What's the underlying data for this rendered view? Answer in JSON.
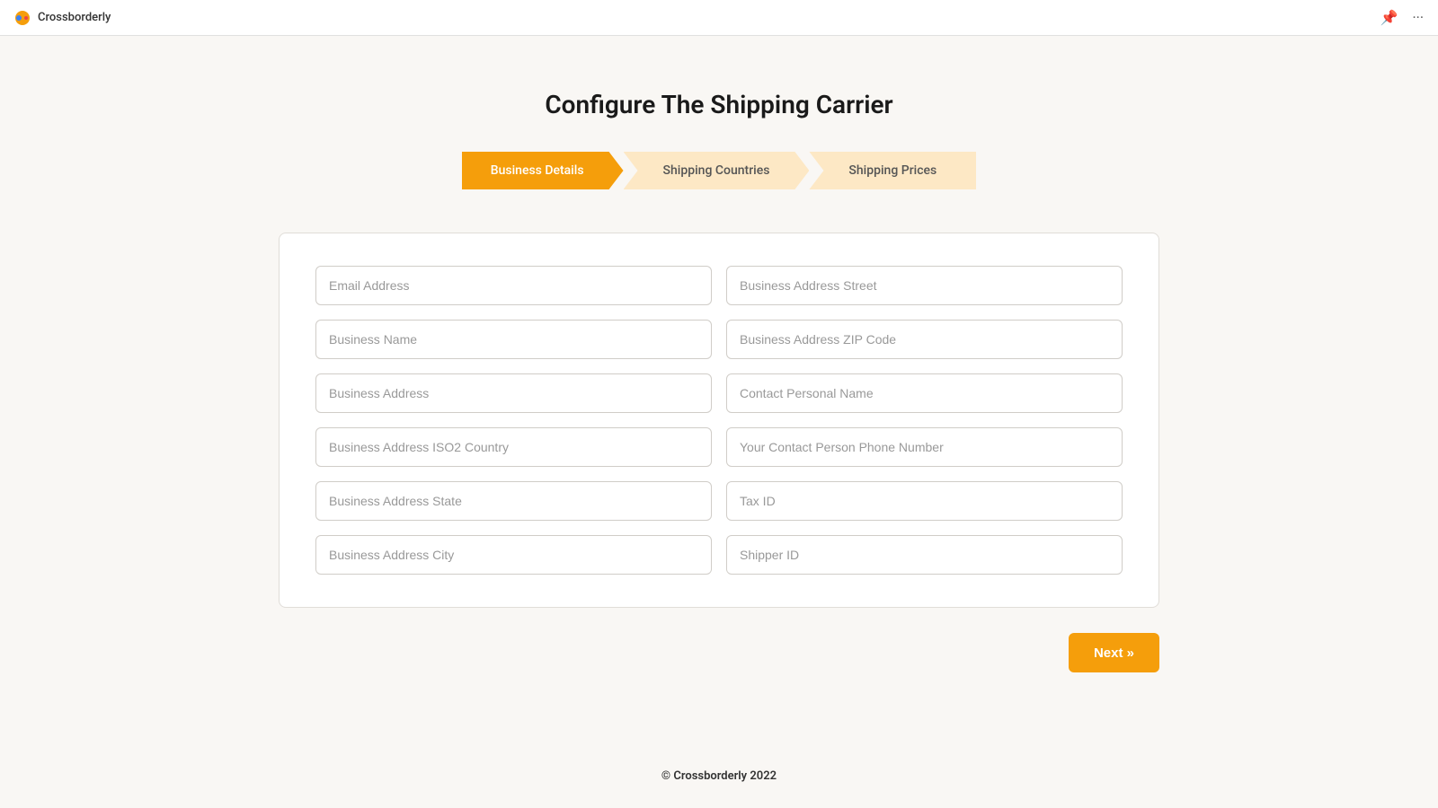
{
  "topbar": {
    "app_name": "Crossborderly",
    "pin_icon": "📌",
    "more_icon": "···"
  },
  "page": {
    "title": "Configure The Shipping Carrier"
  },
  "stepper": {
    "steps": [
      {
        "id": "business-details",
        "label": "Business Details",
        "active": true
      },
      {
        "id": "shipping-countries",
        "label": "Shipping Countries",
        "active": false
      },
      {
        "id": "shipping-prices",
        "label": "Shipping Prices",
        "active": false
      }
    ]
  },
  "form": {
    "fields_left": [
      {
        "id": "email-address",
        "placeholder": "Email Address"
      },
      {
        "id": "business-name",
        "placeholder": "Business Name"
      },
      {
        "id": "business-address",
        "placeholder": "Business Address"
      },
      {
        "id": "business-address-iso2",
        "placeholder": "Business Address ISO2 Country"
      },
      {
        "id": "business-address-state",
        "placeholder": "Business Address State"
      },
      {
        "id": "business-address-city",
        "placeholder": "Business Address City"
      }
    ],
    "fields_right": [
      {
        "id": "business-address-street",
        "placeholder": "Business Address Street"
      },
      {
        "id": "business-address-zip",
        "placeholder": "Business Address ZIP Code"
      },
      {
        "id": "contact-personal-name",
        "placeholder": "Contact Personal Name"
      },
      {
        "id": "contact-phone",
        "placeholder": "Your Contact Person Phone Number"
      },
      {
        "id": "tax-id",
        "placeholder": "Tax ID"
      },
      {
        "id": "shipper-id",
        "placeholder": "Shipper ID"
      }
    ]
  },
  "buttons": {
    "next_label": "Next »"
  },
  "footer": {
    "text": "© Crossborderly 2022"
  }
}
